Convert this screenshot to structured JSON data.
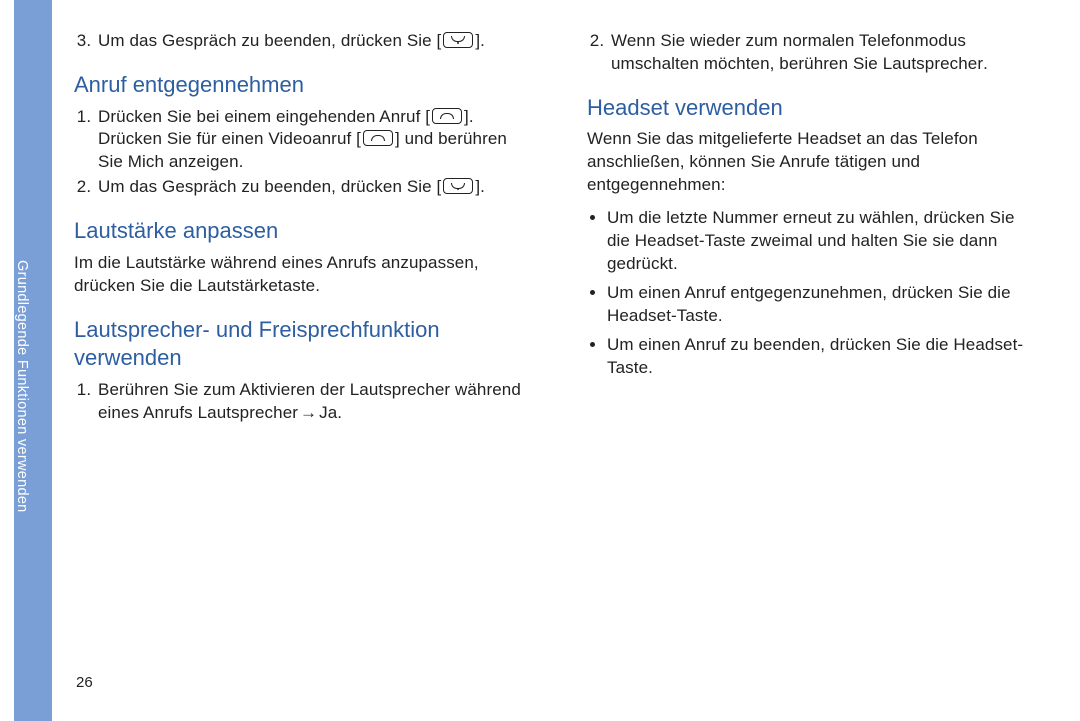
{
  "sidebar": {
    "label": "Grundlegende Funktionen verwenden"
  },
  "page_number": "26",
  "left": {
    "item3_a": "Um das Gespräch zu beenden, drücken Sie [",
    "item3_b": "].",
    "h1": "Anruf entgegennehmen",
    "o1_a": "Drücken Sie bei einem eingehenden Anruf [",
    "o1_b": "].",
    "o1_c": "Drücken Sie für einen Videoanruf [",
    "o1_d": "] und berühren Sie ",
    "o1_e": "Mich anzeigen",
    "o1_f": ".",
    "o2_a": "Um das Gespräch zu beenden, drücken Sie [",
    "o2_b": "].",
    "h2": "Lautstärke anpassen",
    "p2": "Im die Lautstärke während eines Anrufs anzupassen, drücken Sie die Lautstärketaste.",
    "h3": "Lautsprecher- und Freisprechfunktion verwenden",
    "o3": "Berühren Sie zum Aktivieren der Lautsprecher während eines Anrufs ",
    "o3_b": "Lautsprecher",
    "o3_arrow": " → ",
    "o3_c": "Ja",
    "o3_d": "."
  },
  "right": {
    "o2_a": "Wenn Sie wieder zum normalen Telefonmodus umschalten möchten, berühren Sie ",
    "o2_b": "Lautsprecher",
    "o2_c": ".",
    "h1": "Headset verwenden",
    "p1": "Wenn Sie das mitgelieferte Headset an das Telefon anschließen, können Sie Anrufe tätigen und entgegennehmen:",
    "b1": "Um die letzte Nummer erneut zu wählen, drücken Sie die Headset-Taste zweimal und halten Sie sie dann gedrückt.",
    "b2": "Um einen Anruf entgegenzunehmen, drücken Sie die Headset-Taste.",
    "b3": "Um einen Anruf zu beenden, drücken Sie die Headset-Taste."
  }
}
